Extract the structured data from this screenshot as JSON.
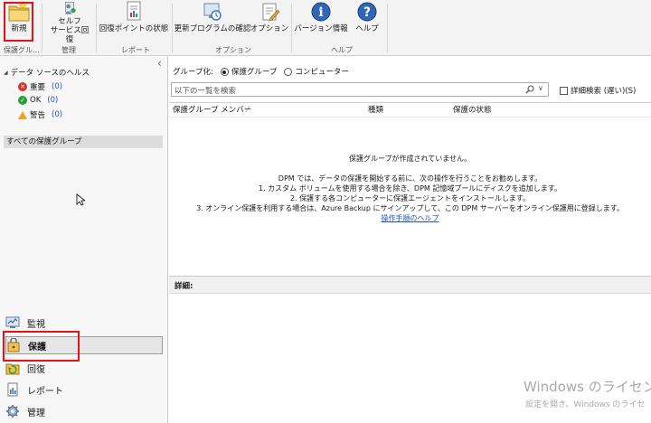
{
  "ribbon": {
    "buttons": [
      {
        "name": "new-button",
        "label": "新規",
        "icon": "new-folder-icon"
      },
      {
        "name": "self-service-recovery-button",
        "label": "セルフ\nサービス回復",
        "icon": "self-service-icon"
      },
      {
        "name": "recovery-point-status-button",
        "label": "回復ポイントの状態",
        "icon": "report-icon"
      },
      {
        "name": "check-updates-button",
        "label": "更新プログラムの確認",
        "icon": "update-icon"
      },
      {
        "name": "options-button",
        "label": "オプション",
        "icon": "options-icon"
      },
      {
        "name": "version-info-button",
        "label": "バージョン情報",
        "icon": "info-icon"
      },
      {
        "name": "help-button",
        "label": "ヘルプ",
        "icon": "help-icon"
      }
    ],
    "groups": {
      "protection": "保護グル...",
      "manage": "管理",
      "report": "レポート",
      "options": "オプション",
      "help": "ヘルプ"
    }
  },
  "left": {
    "collapse_glyph": "‹",
    "health_title": "データ ソースのヘルス",
    "health": [
      {
        "label": "重要",
        "count": "(0)",
        "color": "#d9302c"
      },
      {
        "label": "OK",
        "count": "(0)",
        "color": "#2e9c3a"
      },
      {
        "label": "警告",
        "count": "(0)",
        "color": "#e5a623"
      }
    ],
    "all_groups": "すべての保護グループ",
    "nav": [
      {
        "label": "監視",
        "icon": "monitor-icon"
      },
      {
        "label": "保護",
        "icon": "protection-icon"
      },
      {
        "label": "回復",
        "icon": "recovery-icon"
      },
      {
        "label": "レポート",
        "icon": "reports-icon"
      },
      {
        "label": "管理",
        "icon": "management-icon"
      }
    ]
  },
  "main": {
    "group_by_label": "グループ化:",
    "group_by_protection": "保護グループ",
    "group_by_computer": "コンピューター",
    "search_placeholder": "以下の一覧を検索",
    "advanced_search": "詳細検索 (遅い)(S)",
    "columns": [
      "保護グループ メンバー",
      "種類",
      "保護の状態"
    ],
    "empty_title": "保護グループが作成されていません。",
    "empty_intro": "DPM では、データの保護を開始する前に、次の操作を行うことをお勧めします。",
    "steps": [
      "1. カスタム ボリュームを使用する場合を除き、DPM 記憶域プールにディスクを追加します。",
      "2. 保護する各コンピューターに保護エージェントをインストールします。",
      "3. オンライン保護を利用する場合は、Azure Backup にサインアップして、この DPM サーバーをオンライン保護用に登録します。"
    ],
    "help_link": "操作手順のヘルプ",
    "details_label": "詳細:"
  },
  "watermark": {
    "line1": "Windows のライセンス認",
    "line2": "設定を開き、Windows のライセ"
  }
}
